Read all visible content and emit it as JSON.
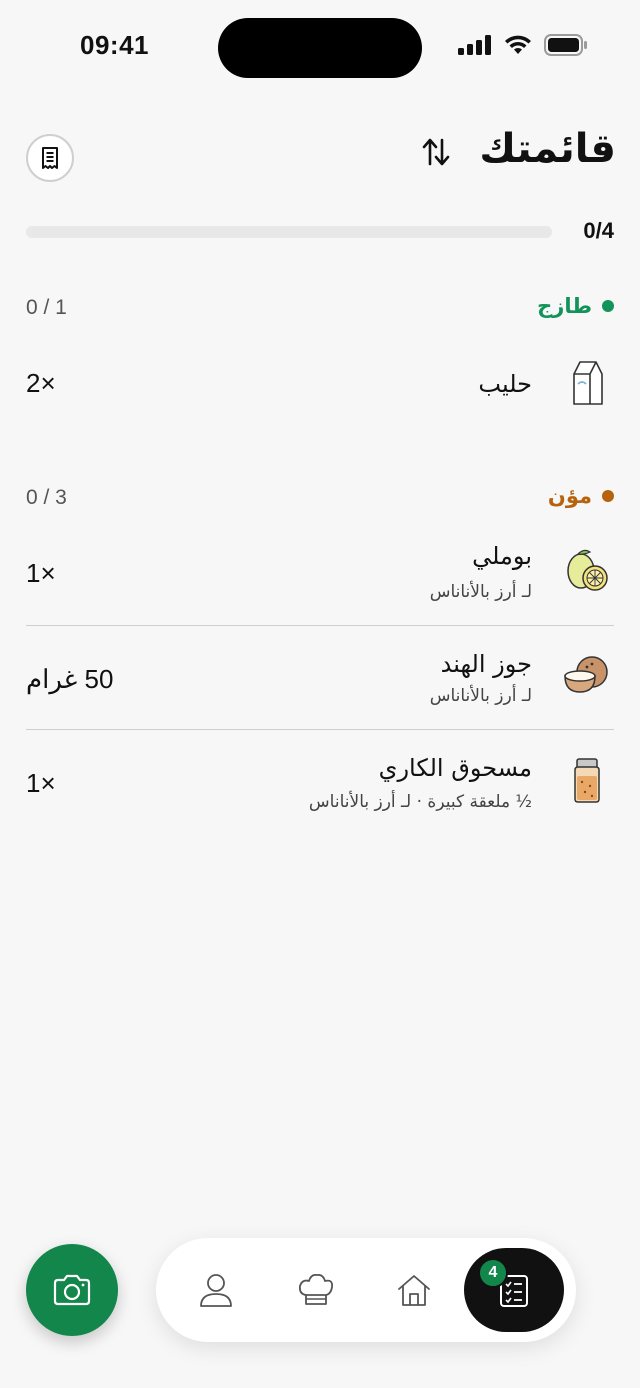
{
  "status_bar": {
    "time": "09:41",
    "icons": [
      "cellular-signal-icon",
      "wifi-icon",
      "battery-icon"
    ]
  },
  "header": {
    "title": "قائمتك",
    "sort_icon": "sort-arrows-icon",
    "receipt_icon": "receipt-icon"
  },
  "progress": {
    "label": "0/4",
    "checked": 0,
    "total": 4
  },
  "sections": [
    {
      "title": "طازج",
      "count": "0 / 1",
      "color": "#12935a",
      "items": [
        {
          "name": "حليب",
          "qty": "×2",
          "icon": "milk-carton-icon"
        }
      ]
    },
    {
      "title": "مؤن",
      "count": "0 / 3",
      "color": "#b6620e",
      "items": [
        {
          "name": "بوملي",
          "sub": "لـ أرز بالأناناس",
          "qty": "×1",
          "icon": "pomelo-icon"
        },
        {
          "name": "جوز الهند",
          "sub": "لـ أرز بالأناناس",
          "qty": "50 غرام",
          "icon": "coconut-icon"
        },
        {
          "name": "مسحوق الكاري",
          "sub": "½ ملعقة كبيرة · لـ أرز بالأناناس",
          "qty": "×1",
          "icon": "spice-jar-icon"
        }
      ]
    }
  ],
  "bottom_nav": {
    "camera_icon": "camera-icon",
    "items": [
      "profile-icon",
      "chef-hat-icon",
      "home-icon",
      "checklist-icon"
    ],
    "active": "checklist-icon",
    "badge": "4"
  },
  "colors": {
    "accent": "#13864c",
    "background": "#f7f7f7"
  }
}
